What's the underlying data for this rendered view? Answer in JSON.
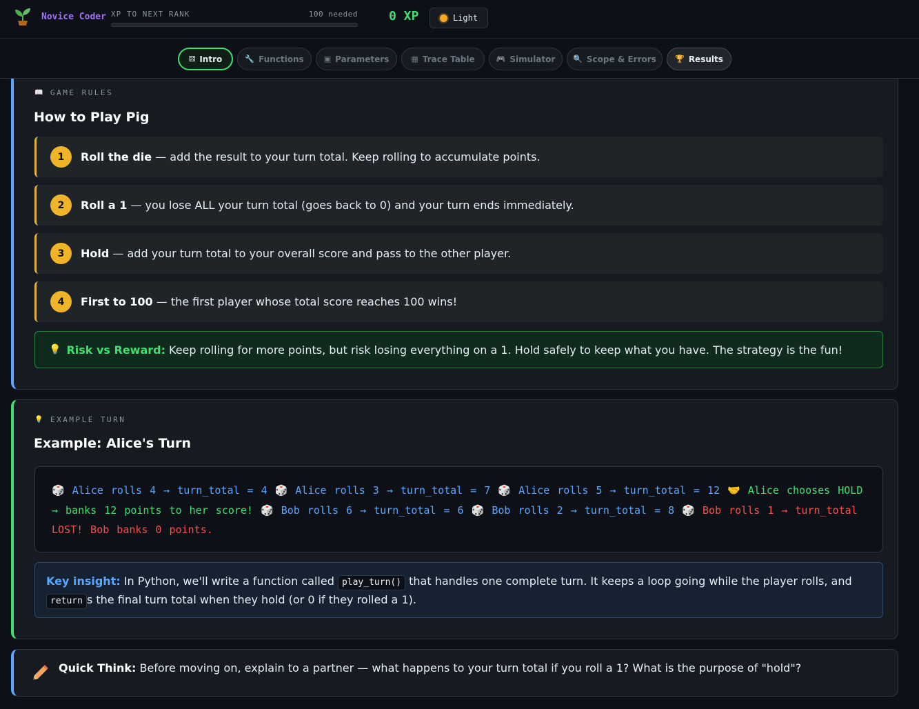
{
  "topbar": {
    "rank_name": "Novice Coder",
    "xp_label": "XP TO NEXT RANK",
    "xp_needed": "100 needed",
    "xp_progress_percent": 0,
    "xp_value": "0 XP",
    "theme_label": "Light",
    "icons": {
      "rank": "sprout-icon",
      "theme": "sun-icon"
    }
  },
  "nav": {
    "tabs": [
      {
        "label": "Intro",
        "icon": "die-icon"
      },
      {
        "label": "Functions",
        "icon": "wrench-icon"
      },
      {
        "label": "Parameters",
        "icon": "box-icon"
      },
      {
        "label": "Trace Table",
        "icon": "chart-icon"
      },
      {
        "label": "Simulator",
        "icon": "gamepad-icon"
      },
      {
        "label": "Scope & Errors",
        "icon": "magnifier-icon"
      },
      {
        "label": "Results",
        "icon": "trophy-icon"
      }
    ],
    "active": "Intro"
  },
  "rules": {
    "label": "GAME RULES",
    "title": "How to Play Pig",
    "items": [
      {
        "num": "1",
        "strong": "Roll the die",
        "text": " — add the result to your turn total. Keep rolling to accumulate points."
      },
      {
        "num": "2",
        "strong": "Roll a 1",
        "text": " — you lose ALL your turn total (goes back to 0) and your turn ends immediately."
      },
      {
        "num": "3",
        "strong": "Hold",
        "text": " — add your turn total to your overall score and pass to the other player."
      },
      {
        "num": "4",
        "strong": "First to 100",
        "text": " — the first player whose total score reaches 100 wins!"
      }
    ],
    "callout_strong": "Risk vs Reward:",
    "callout_text": "Keep rolling for more points, but risk losing everything on a 1. Hold safely to keep what you have. The strategy is the fun!"
  },
  "example": {
    "label": "EXAMPLE TURN",
    "title": "Example: Alice's Turn",
    "lines": {
      "a1": "Alice rolls 4 → turn_total = 4",
      "a2": "Alice rolls 3 → turn_total = 7",
      "a3": "Alice rolls 5 → turn_total = 12",
      "a4": "Alice chooses HOLD → banks 12 points to her score!",
      "b1": "Bob rolls 6 → turn_total = 6",
      "b2": "Bob rolls 2 → turn_total = 8",
      "b3": "Bob rolls 1 → turn_total LOST! Bob banks 0 points."
    },
    "insight_strong": "Key insight:",
    "insight_pre": " In Python, we'll write a function called ",
    "insight_code1": "play_turn()",
    "insight_mid": " that handles one complete turn. It keeps a loop going while the player rolls, and ",
    "insight_code2": "return",
    "insight_post": "s the final turn total when they hold (or 0 if they rolled a 1)."
  },
  "think": {
    "strong": "Quick Think:",
    "text": " Before moving on, explain to a partner — what happens to your turn total if you roll a 1? What is the purpose of \"hold\"?",
    "icon": "pencil-icon"
  },
  "colors": {
    "accent_green": "#3fe070",
    "accent_blue": "#58a6ff",
    "accent_yellow": "#f0b429",
    "accent_red": "#f85149"
  }
}
